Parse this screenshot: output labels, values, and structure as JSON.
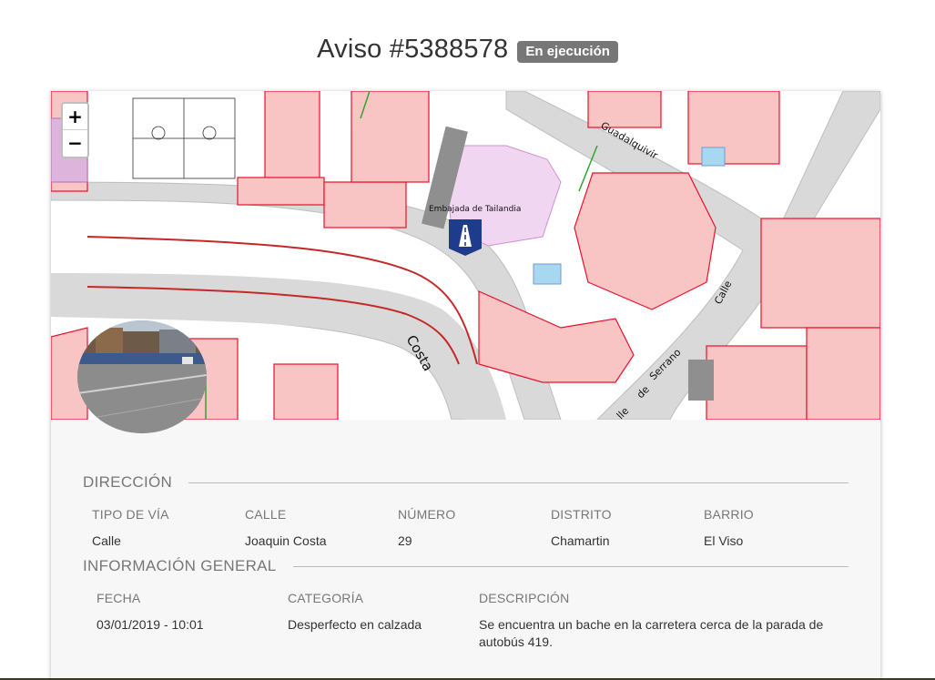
{
  "header": {
    "title": "Aviso #5388578",
    "status": "En ejecución"
  },
  "map": {
    "zoom_in": "+",
    "zoom_out": "−",
    "labels": {
      "embassy": "Embajada de Tailandia",
      "street_guadalquivir": "Guadalquivir",
      "street_costa": "Costa",
      "street_calle": "Calle",
      "street_serrano": "Serrano",
      "street_de": "de",
      "street_lle": "lle"
    },
    "marker_icon": "road-icon"
  },
  "direccion": {
    "title": "DIRECCIÓN",
    "fields": [
      {
        "label": "TIPO DE VÍA",
        "value": "Calle"
      },
      {
        "label": "CALLE",
        "value": "Joaquin Costa"
      },
      {
        "label": "NÚMERO",
        "value": "29"
      },
      {
        "label": "DISTRITO",
        "value": "Chamartin"
      },
      {
        "label": "BARRIO",
        "value": "El Viso"
      }
    ]
  },
  "general": {
    "title": "INFORMACIÓN GENERAL",
    "fields": [
      {
        "label": "FECHA",
        "value": "03/01/2019 - 10:01"
      },
      {
        "label": "CATEGORÍA",
        "value": "Desperfecto en calzada"
      },
      {
        "label": "DESCRIPCIÓN",
        "value": "Se encuentra un bache en la carretera cerca de la parada de autobús 419."
      }
    ]
  },
  "colors": {
    "badge": "#777777",
    "parcel": "#f9c4c4",
    "parcel_border": "#e8102a",
    "road": "#d9d9d9",
    "marker": "#1f3c8c"
  }
}
